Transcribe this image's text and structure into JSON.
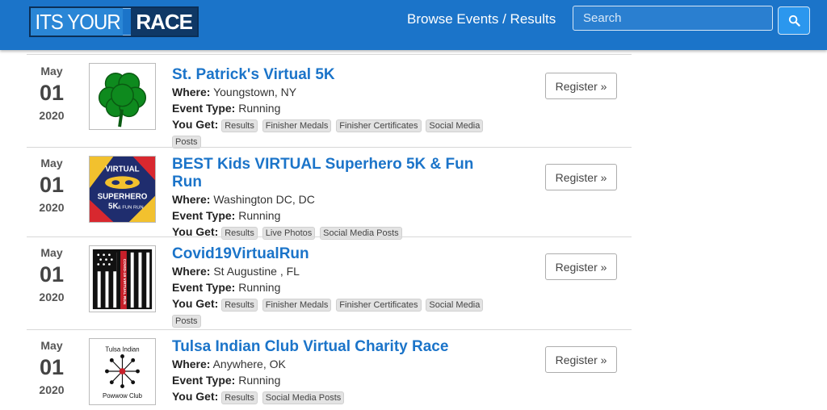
{
  "header": {
    "logo_part1": "ITS YOUR",
    "logo_part2": "RACE",
    "nav_link": "Browse Events / Results",
    "search_placeholder": "Search",
    "brand_color": "#1b74c9"
  },
  "labels": {
    "where": "Where:",
    "event_type": "Event Type:",
    "you_get": "You Get:",
    "register": "Register »"
  },
  "events": [
    {
      "month": "May",
      "day": "01",
      "year": "2020",
      "title": "St. Patrick's Virtual 5K",
      "where": "Youngstown, NY",
      "event_type": "Running",
      "perks": [
        "Results",
        "Finisher Medals",
        "Finisher Certificates",
        "Social Media"
      ],
      "perks_wrap": [
        "Posts"
      ],
      "image": "shamrock"
    },
    {
      "month": "May",
      "day": "01",
      "year": "2020",
      "title": "BEST Kids VIRTUAL Superhero 5K & Fun Run",
      "where": "Washington DC, DC",
      "event_type": "Running",
      "perks": [
        "Results",
        "Live Photos",
        "Social Media Posts"
      ],
      "perks_wrap": [],
      "image": "superhero-logo",
      "image_text": [
        "VIRTUAL",
        "SUPERHERO",
        "5K",
        "& FUN RUN"
      ]
    },
    {
      "month": "May",
      "day": "01",
      "year": "2020",
      "title": "Covid19VirtualRun",
      "where": "St Augustine , FL",
      "event_type": "Running",
      "perks": [
        "Results",
        "Finisher Medals",
        "Finisher Certificates",
        "Social Media"
      ],
      "perks_wrap": [
        "Posts"
      ],
      "image": "flag-logo",
      "image_text": [
        "COVID-19 VIRTUAL RUN"
      ]
    },
    {
      "month": "May",
      "day": "01",
      "year": "2020",
      "title": "Tulsa Indian Club Virtual Charity Race",
      "where": "Anywhere, OK",
      "event_type": "Running",
      "perks": [
        "Results",
        "Social Media Posts"
      ],
      "perks_wrap": [],
      "image": "powwow-logo",
      "image_text": [
        "Tulsa Indian",
        "Powwow Club"
      ]
    }
  ]
}
